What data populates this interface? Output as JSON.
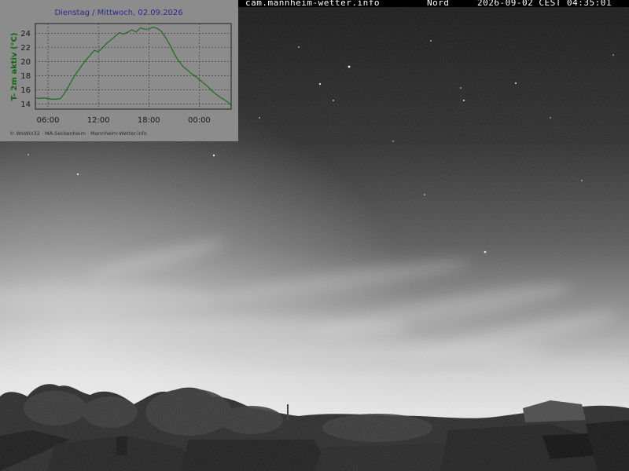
{
  "overlay": {
    "url": "cam.mannheim-wetter.info",
    "direction": "Nord",
    "timestamp": "2026-09-02 CEST 04:35:01"
  },
  "chart_data": {
    "type": "line",
    "title": "Dienstag / Mittwoch, 02.09.2026",
    "ylabel": "T- 2m aktiv (°C)",
    "xlabel": "",
    "xlim": [
      4.5,
      27.8
    ],
    "ylim": [
      13.3,
      25.4
    ],
    "x_ticks": [
      {
        "v": 6,
        "label": "06:00"
      },
      {
        "v": 12,
        "label": "12:00"
      },
      {
        "v": 18,
        "label": "18:00"
      },
      {
        "v": 24,
        "label": "00:00"
      }
    ],
    "y_ticks": [
      14,
      16,
      18,
      20,
      22,
      24
    ],
    "grid": true,
    "credit": "© WsWin32 · MA-Seckenheim · Mannheim-Wetter.info",
    "series": [
      {
        "color": "#1f6b1f",
        "x": [
          4.5,
          5.0,
          5.5,
          6.0,
          6.5,
          7.0,
          7.5,
          8.0,
          8.5,
          9.0,
          9.5,
          10.0,
          10.5,
          11.0,
          11.5,
          12.0,
          12.5,
          13.0,
          13.5,
          14.0,
          14.5,
          15.0,
          15.5,
          16.0,
          16.5,
          17.0,
          17.5,
          18.0,
          18.5,
          19.0,
          19.5,
          20.0,
          20.5,
          21.0,
          21.5,
          22.0,
          22.5,
          23.0,
          23.5,
          24.0,
          24.5,
          25.0,
          25.5,
          26.0,
          26.5,
          27.0,
          27.5,
          27.8
        ],
        "y": [
          14.9,
          14.8,
          14.9,
          14.8,
          14.7,
          14.7,
          14.8,
          15.6,
          16.6,
          17.7,
          18.6,
          19.4,
          20.2,
          20.9,
          21.6,
          21.4,
          22.0,
          22.6,
          23.1,
          23.6,
          24.1,
          23.9,
          24.2,
          24.5,
          24.2,
          24.8,
          24.6,
          24.6,
          24.9,
          24.7,
          24.3,
          23.4,
          22.4,
          21.2,
          20.2,
          19.4,
          18.9,
          18.4,
          18.0,
          17.5,
          17.0,
          16.5,
          15.9,
          15.4,
          15.0,
          14.6,
          14.2,
          13.8
        ]
      }
    ]
  }
}
